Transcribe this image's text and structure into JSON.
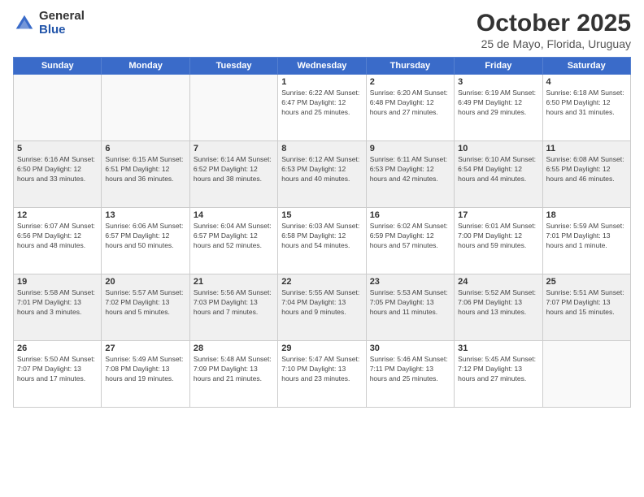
{
  "logo": {
    "general": "General",
    "blue": "Blue"
  },
  "header": {
    "month": "October 2025",
    "location": "25 de Mayo, Florida, Uruguay"
  },
  "days_of_week": [
    "Sunday",
    "Monday",
    "Tuesday",
    "Wednesday",
    "Thursday",
    "Friday",
    "Saturday"
  ],
  "weeks": [
    {
      "shaded": false,
      "days": [
        {
          "date": "",
          "info": ""
        },
        {
          "date": "",
          "info": ""
        },
        {
          "date": "",
          "info": ""
        },
        {
          "date": "1",
          "info": "Sunrise: 6:22 AM\nSunset: 6:47 PM\nDaylight: 12 hours\nand 25 minutes."
        },
        {
          "date": "2",
          "info": "Sunrise: 6:20 AM\nSunset: 6:48 PM\nDaylight: 12 hours\nand 27 minutes."
        },
        {
          "date": "3",
          "info": "Sunrise: 6:19 AM\nSunset: 6:49 PM\nDaylight: 12 hours\nand 29 minutes."
        },
        {
          "date": "4",
          "info": "Sunrise: 6:18 AM\nSunset: 6:50 PM\nDaylight: 12 hours\nand 31 minutes."
        }
      ]
    },
    {
      "shaded": true,
      "days": [
        {
          "date": "5",
          "info": "Sunrise: 6:16 AM\nSunset: 6:50 PM\nDaylight: 12 hours\nand 33 minutes."
        },
        {
          "date": "6",
          "info": "Sunrise: 6:15 AM\nSunset: 6:51 PM\nDaylight: 12 hours\nand 36 minutes."
        },
        {
          "date": "7",
          "info": "Sunrise: 6:14 AM\nSunset: 6:52 PM\nDaylight: 12 hours\nand 38 minutes."
        },
        {
          "date": "8",
          "info": "Sunrise: 6:12 AM\nSunset: 6:53 PM\nDaylight: 12 hours\nand 40 minutes."
        },
        {
          "date": "9",
          "info": "Sunrise: 6:11 AM\nSunset: 6:53 PM\nDaylight: 12 hours\nand 42 minutes."
        },
        {
          "date": "10",
          "info": "Sunrise: 6:10 AM\nSunset: 6:54 PM\nDaylight: 12 hours\nand 44 minutes."
        },
        {
          "date": "11",
          "info": "Sunrise: 6:08 AM\nSunset: 6:55 PM\nDaylight: 12 hours\nand 46 minutes."
        }
      ]
    },
    {
      "shaded": false,
      "days": [
        {
          "date": "12",
          "info": "Sunrise: 6:07 AM\nSunset: 6:56 PM\nDaylight: 12 hours\nand 48 minutes."
        },
        {
          "date": "13",
          "info": "Sunrise: 6:06 AM\nSunset: 6:57 PM\nDaylight: 12 hours\nand 50 minutes."
        },
        {
          "date": "14",
          "info": "Sunrise: 6:04 AM\nSunset: 6:57 PM\nDaylight: 12 hours\nand 52 minutes."
        },
        {
          "date": "15",
          "info": "Sunrise: 6:03 AM\nSunset: 6:58 PM\nDaylight: 12 hours\nand 54 minutes."
        },
        {
          "date": "16",
          "info": "Sunrise: 6:02 AM\nSunset: 6:59 PM\nDaylight: 12 hours\nand 57 minutes."
        },
        {
          "date": "17",
          "info": "Sunrise: 6:01 AM\nSunset: 7:00 PM\nDaylight: 12 hours\nand 59 minutes."
        },
        {
          "date": "18",
          "info": "Sunrise: 5:59 AM\nSunset: 7:01 PM\nDaylight: 13 hours\nand 1 minute."
        }
      ]
    },
    {
      "shaded": true,
      "days": [
        {
          "date": "19",
          "info": "Sunrise: 5:58 AM\nSunset: 7:01 PM\nDaylight: 13 hours\nand 3 minutes."
        },
        {
          "date": "20",
          "info": "Sunrise: 5:57 AM\nSunset: 7:02 PM\nDaylight: 13 hours\nand 5 minutes."
        },
        {
          "date": "21",
          "info": "Sunrise: 5:56 AM\nSunset: 7:03 PM\nDaylight: 13 hours\nand 7 minutes."
        },
        {
          "date": "22",
          "info": "Sunrise: 5:55 AM\nSunset: 7:04 PM\nDaylight: 13 hours\nand 9 minutes."
        },
        {
          "date": "23",
          "info": "Sunrise: 5:53 AM\nSunset: 7:05 PM\nDaylight: 13 hours\nand 11 minutes."
        },
        {
          "date": "24",
          "info": "Sunrise: 5:52 AM\nSunset: 7:06 PM\nDaylight: 13 hours\nand 13 minutes."
        },
        {
          "date": "25",
          "info": "Sunrise: 5:51 AM\nSunset: 7:07 PM\nDaylight: 13 hours\nand 15 minutes."
        }
      ]
    },
    {
      "shaded": false,
      "days": [
        {
          "date": "26",
          "info": "Sunrise: 5:50 AM\nSunset: 7:07 PM\nDaylight: 13 hours\nand 17 minutes."
        },
        {
          "date": "27",
          "info": "Sunrise: 5:49 AM\nSunset: 7:08 PM\nDaylight: 13 hours\nand 19 minutes."
        },
        {
          "date": "28",
          "info": "Sunrise: 5:48 AM\nSunset: 7:09 PM\nDaylight: 13 hours\nand 21 minutes."
        },
        {
          "date": "29",
          "info": "Sunrise: 5:47 AM\nSunset: 7:10 PM\nDaylight: 13 hours\nand 23 minutes."
        },
        {
          "date": "30",
          "info": "Sunrise: 5:46 AM\nSunset: 7:11 PM\nDaylight: 13 hours\nand 25 minutes."
        },
        {
          "date": "31",
          "info": "Sunrise: 5:45 AM\nSunset: 7:12 PM\nDaylight: 13 hours\nand 27 minutes."
        },
        {
          "date": "",
          "info": ""
        }
      ]
    }
  ]
}
